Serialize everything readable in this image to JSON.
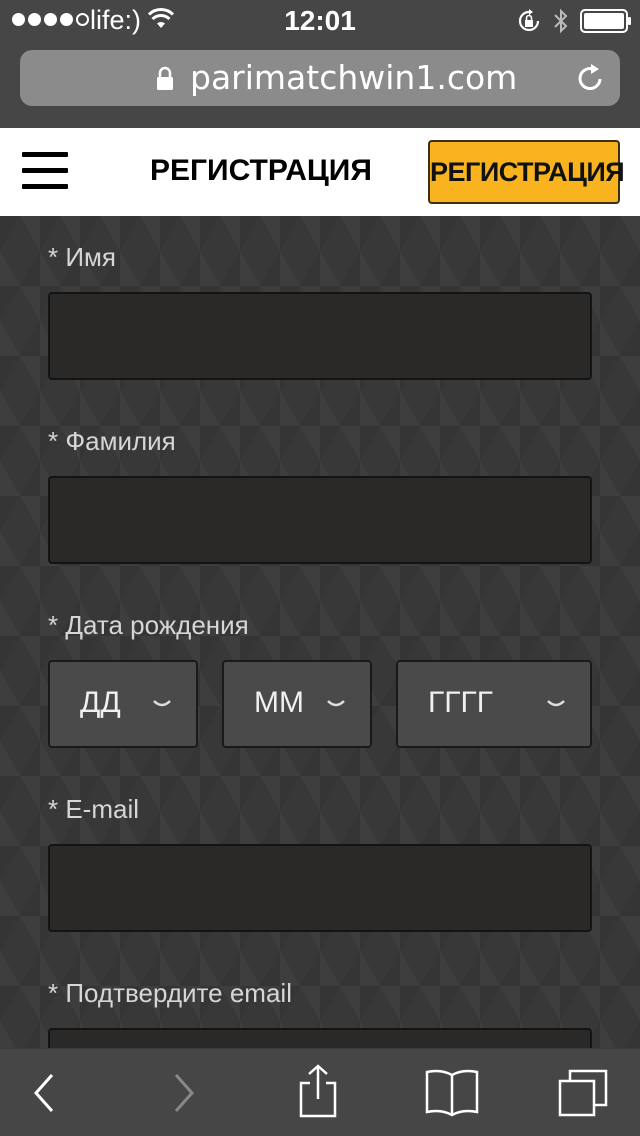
{
  "status_bar": {
    "carrier": "life:)",
    "time": "12:01"
  },
  "browser": {
    "url": "parimatchwin1.com"
  },
  "header": {
    "title": "РЕГИСТРАЦИЯ",
    "register_button": "РЕГИСТРАЦИЯ"
  },
  "form": {
    "first_name_label": "* Имя",
    "last_name_label": "* Фамилия",
    "birthdate_label": "* Дата рождения",
    "day_value": "ДД",
    "month_value": "ММ",
    "year_value": "ГГГГ",
    "email_label": "* E-mail",
    "confirm_email_label": "* Подтвердите email"
  },
  "colors": {
    "accent": "#f8b31f",
    "page_bg": "#383838",
    "input_bg": "#2a2928"
  }
}
